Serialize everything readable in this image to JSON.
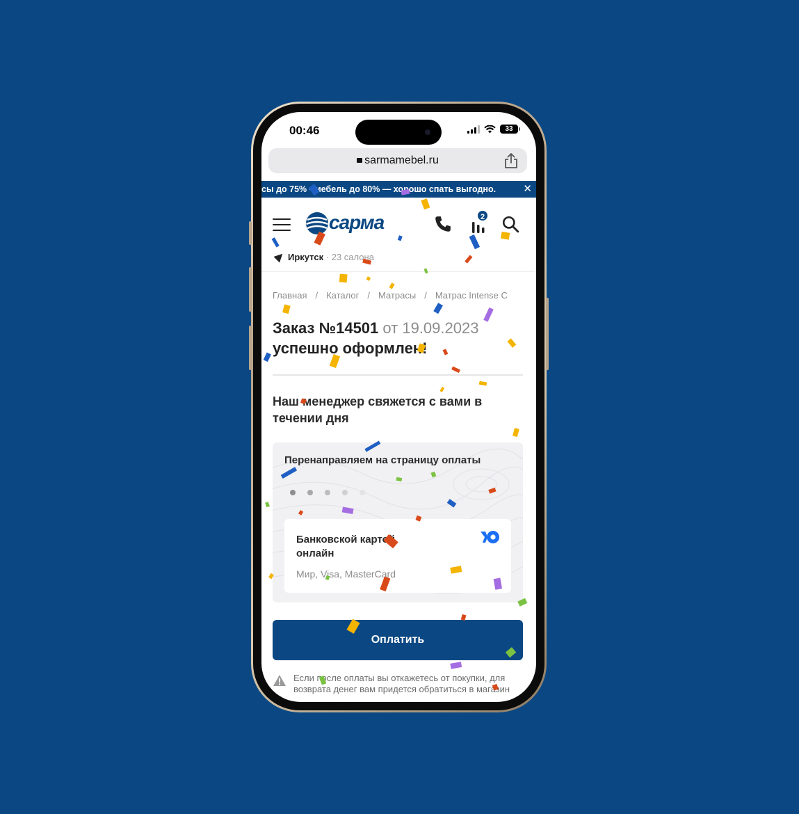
{
  "status_bar": {
    "time": "00:46",
    "battery": "33"
  },
  "browser": {
    "url": "sarmamebel.ru"
  },
  "promo": {
    "text": "сы до 75% • мебель до 80% — хорошо спать выгодно.",
    "close": "✕"
  },
  "header": {
    "logo": "сарма",
    "compare_count": "2",
    "city": "Иркутск",
    "city_count": "· 23 салона"
  },
  "breadcrumb": {
    "items": [
      "Главная",
      "Каталог",
      "Матрасы",
      "Матрас Intense C"
    ],
    "separator": "/"
  },
  "order": {
    "title_prefix": "Заказ №14501",
    "date": "от 19.09.2023",
    "title_suffix": "успешно оформлен!"
  },
  "manager_text": "Наш менеджер свяжется с вами в течении дня",
  "payment": {
    "redirect_text": "Перенаправляем на страницу оплаты",
    "method_title": "Банковской картой онлайн",
    "method_sub": "Мир, Visa, MasterCard",
    "provider_icon": "yoomoney-icon",
    "button": "Оплатить"
  },
  "warning": {
    "text": "Если после оплаты вы откажетесь от покупки, для возврата денег вам придется обратиться в магазин"
  },
  "colors": {
    "brand": "#0b4883",
    "background": "#0b4883",
    "yoomoney": "#1b6ff5"
  }
}
